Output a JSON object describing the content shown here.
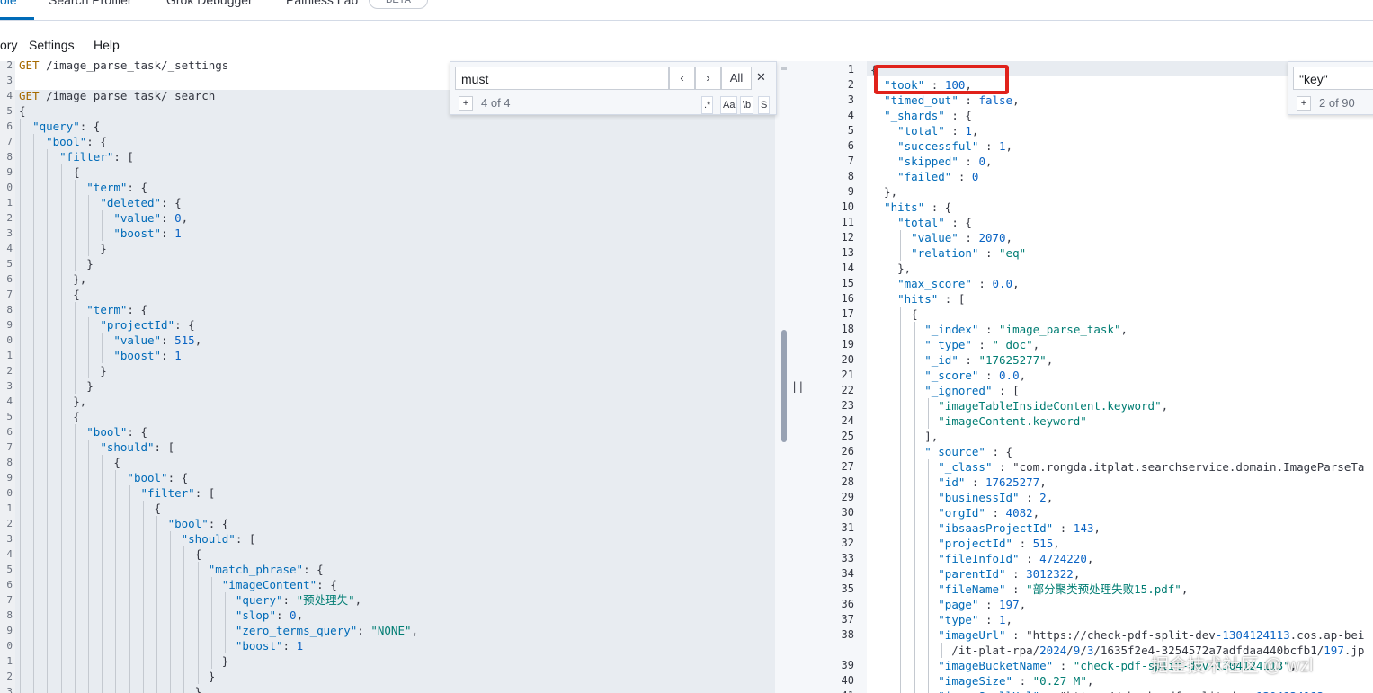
{
  "tabs": {
    "console": "ole",
    "search_profiler": "Search Profiler",
    "grok_debugger": "Grok Debugger",
    "painless_lab": "Painless Lab",
    "beta": "BETA"
  },
  "menu": {
    "history": "ory",
    "settings": "Settings",
    "help": "Help"
  },
  "left_search": {
    "value": "must",
    "prev": "‹",
    "next": "›",
    "all": "All",
    "close": "✕",
    "add": "+",
    "count": "4 of 4",
    "regex": ".*",
    "case": "Aa",
    "word": "\\b",
    "selection": "S"
  },
  "right_search": {
    "value": "\"key\"",
    "add": "+",
    "count": "2 of 90"
  },
  "resize_handle": "||",
  "watermark": "掘金技术社区 @ wzl",
  "left_lines": [
    {
      "n": "2",
      "t": "GET /image_parse_task/_settings"
    },
    {
      "n": "3",
      "t": ""
    },
    {
      "n": "4",
      "t": "GET /image_parse_task/_search"
    },
    {
      "n": "5",
      "t": "{"
    },
    {
      "n": "6",
      "t": "  \"query\": {"
    },
    {
      "n": "7",
      "t": "    \"bool\": {"
    },
    {
      "n": "8",
      "t": "      \"filter\": ["
    },
    {
      "n": "9",
      "t": "        {"
    },
    {
      "n": "0",
      "t": "          \"term\": {"
    },
    {
      "n": "1",
      "t": "            \"deleted\": {"
    },
    {
      "n": "2",
      "t": "              \"value\": 0,"
    },
    {
      "n": "3",
      "t": "              \"boost\": 1"
    },
    {
      "n": "4",
      "t": "            }"
    },
    {
      "n": "5",
      "t": "          }"
    },
    {
      "n": "6",
      "t": "        },"
    },
    {
      "n": "7",
      "t": "        {"
    },
    {
      "n": "8",
      "t": "          \"term\": {"
    },
    {
      "n": "9",
      "t": "            \"projectId\": {"
    },
    {
      "n": "0",
      "t": "              \"value\": 515,"
    },
    {
      "n": "1",
      "t": "              \"boost\": 1"
    },
    {
      "n": "2",
      "t": "            }"
    },
    {
      "n": "3",
      "t": "          }"
    },
    {
      "n": "4",
      "t": "        },"
    },
    {
      "n": "5",
      "t": "        {"
    },
    {
      "n": "6",
      "t": "          \"bool\": {"
    },
    {
      "n": "7",
      "t": "            \"should\": ["
    },
    {
      "n": "8",
      "t": "              {"
    },
    {
      "n": "9",
      "t": "                \"bool\": {"
    },
    {
      "n": "0",
      "t": "                  \"filter\": ["
    },
    {
      "n": "1",
      "t": "                    {"
    },
    {
      "n": "2",
      "t": "                      \"bool\": {"
    },
    {
      "n": "3",
      "t": "                        \"should\": ["
    },
    {
      "n": "4",
      "t": "                          {"
    },
    {
      "n": "5",
      "t": "                            \"match_phrase\": {"
    },
    {
      "n": "6",
      "t": "                              \"imageContent\": {"
    },
    {
      "n": "7",
      "t": "                                \"query\": \"预处理失\","
    },
    {
      "n": "8",
      "t": "                                \"slop\": 0,"
    },
    {
      "n": "9",
      "t": "                                \"zero_terms_query\": \"NONE\","
    },
    {
      "n": "0",
      "t": "                                \"boost\": 1"
    },
    {
      "n": "1",
      "t": "                              }"
    },
    {
      "n": "2",
      "t": "                            }"
    },
    {
      "n": "3",
      "t": "                          }"
    }
  ],
  "right_lines": [
    {
      "n": "1",
      "t": "{"
    },
    {
      "n": "2",
      "t": "  \"took\" : 100,"
    },
    {
      "n": "3",
      "t": "  \"timed_out\" : false,"
    },
    {
      "n": "4",
      "t": "  \"_shards\" : {"
    },
    {
      "n": "5",
      "t": "    \"total\" : 1,"
    },
    {
      "n": "6",
      "t": "    \"successful\" : 1,"
    },
    {
      "n": "7",
      "t": "    \"skipped\" : 0,"
    },
    {
      "n": "8",
      "t": "    \"failed\" : 0"
    },
    {
      "n": "9",
      "t": "  },"
    },
    {
      "n": "10",
      "t": "  \"hits\" : {"
    },
    {
      "n": "11",
      "t": "    \"total\" : {"
    },
    {
      "n": "12",
      "t": "      \"value\" : 2070,"
    },
    {
      "n": "13",
      "t": "      \"relation\" : \"eq\""
    },
    {
      "n": "14",
      "t": "    },"
    },
    {
      "n": "15",
      "t": "    \"max_score\" : 0.0,"
    },
    {
      "n": "16",
      "t": "    \"hits\" : ["
    },
    {
      "n": "17",
      "t": "      {"
    },
    {
      "n": "18",
      "t": "        \"_index\" : \"image_parse_task\","
    },
    {
      "n": "19",
      "t": "        \"_type\" : \"_doc\","
    },
    {
      "n": "20",
      "t": "        \"_id\" : \"17625277\","
    },
    {
      "n": "21",
      "t": "        \"_score\" : 0.0,"
    },
    {
      "n": "22",
      "t": "        \"_ignored\" : ["
    },
    {
      "n": "23",
      "t": "          \"imageTableInsideContent.keyword\","
    },
    {
      "n": "24",
      "t": "          \"imageContent.keyword\""
    },
    {
      "n": "25",
      "t": "        ],"
    },
    {
      "n": "26",
      "t": "        \"_source\" : {"
    },
    {
      "n": "27",
      "t": "          \"_class\" : \"com.rongda.itplat.searchservice.domain.ImageParseTa"
    },
    {
      "n": "28",
      "t": "          \"id\" : 17625277,"
    },
    {
      "n": "29",
      "t": "          \"businessId\" : 2,"
    },
    {
      "n": "30",
      "t": "          \"orgId\" : 4082,"
    },
    {
      "n": "31",
      "t": "          \"ibsaasProjectId\" : 143,"
    },
    {
      "n": "32",
      "t": "          \"projectId\" : 515,"
    },
    {
      "n": "33",
      "t": "          \"fileInfoId\" : 4724220,"
    },
    {
      "n": "34",
      "t": "          \"parentId\" : 3012322,"
    },
    {
      "n": "35",
      "t": "          \"fileName\" : \"部分聚类预处理失败15.pdf\","
    },
    {
      "n": "36",
      "t": "          \"page\" : 197,"
    },
    {
      "n": "37",
      "t": "          \"type\" : 1,"
    },
    {
      "n": "38",
      "t": "          \"imageUrl\" : \"https://check-pdf-split-dev-1304124113.cos.ap-bei"
    },
    {
      "n": "",
      "t": "            /it-plat-rpa/2024/9/3/1635f2e4-3254572a7adfdaa440bcfb1/197.jp"
    },
    {
      "n": "39",
      "t": "          \"imageBucketName\" : \"check-pdf-split-dev-1304124113\","
    },
    {
      "n": "40",
      "t": "          \"imageSize\" : \"0.27 M\","
    },
    {
      "n": "41",
      "t": "          \"imageSmallUrl\" : \"https://check-pdf-split-dev-1304124113"
    }
  ]
}
